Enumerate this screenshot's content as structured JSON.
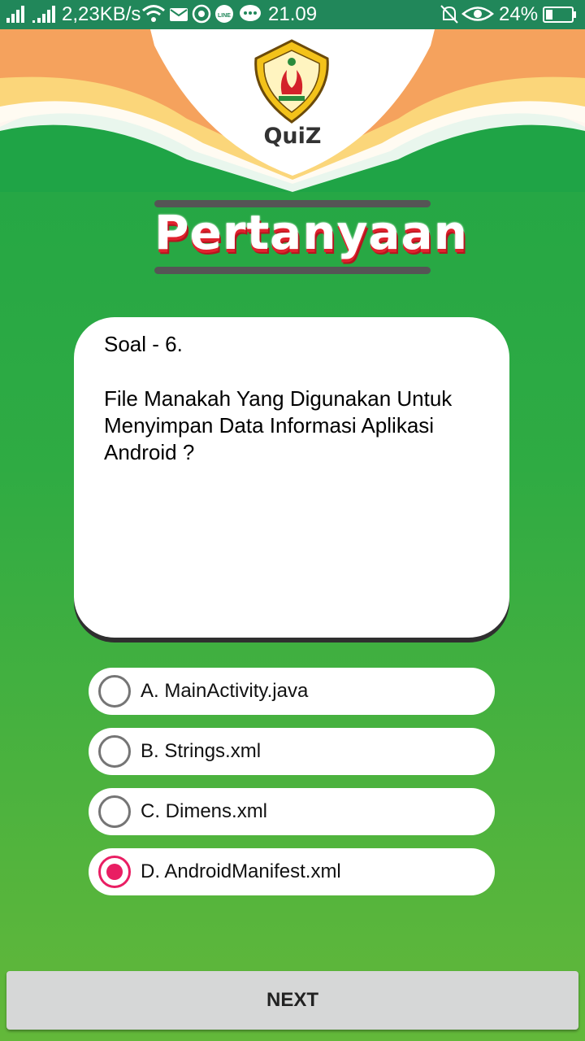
{
  "status_bar": {
    "network_speed": "2,23KB/s",
    "time": "21.09",
    "battery": "24%",
    "icons": [
      "signal-icon",
      "signal-icon",
      "wifi-icon",
      "mail-icon",
      "whatsapp-icon",
      "line-icon",
      "chat-icon",
      "mute-icon",
      "eye-icon",
      "battery-icon"
    ]
  },
  "header": {
    "logo_alt": "UNIVERSITAS PEMBANGUNAN NASIONAL \"VETERAN\" JAWA TIMUR",
    "app_name": "QuiZ",
    "page_title": "Pertanyaan"
  },
  "question": {
    "number_label": "Soal - 6.",
    "text": "File Manakah Yang Digunakan Untuk Menyimpan Data Informasi Aplikasi Android ?"
  },
  "options": [
    {
      "label": "A. MainActivity.java",
      "selected": false
    },
    {
      "label": "B. Strings.xml",
      "selected": false
    },
    {
      "label": "C. Dimens.xml",
      "selected": false
    },
    {
      "label": "D. AndroidManifest.xml",
      "selected": true
    }
  ],
  "next_button": {
    "label": "NEXT"
  },
  "colors": {
    "status_bar": "#21875a",
    "background_green": "#2aa845",
    "accent_radio": "#e91e63",
    "orange": "#f5a25d",
    "title_red": "#e0222e"
  }
}
